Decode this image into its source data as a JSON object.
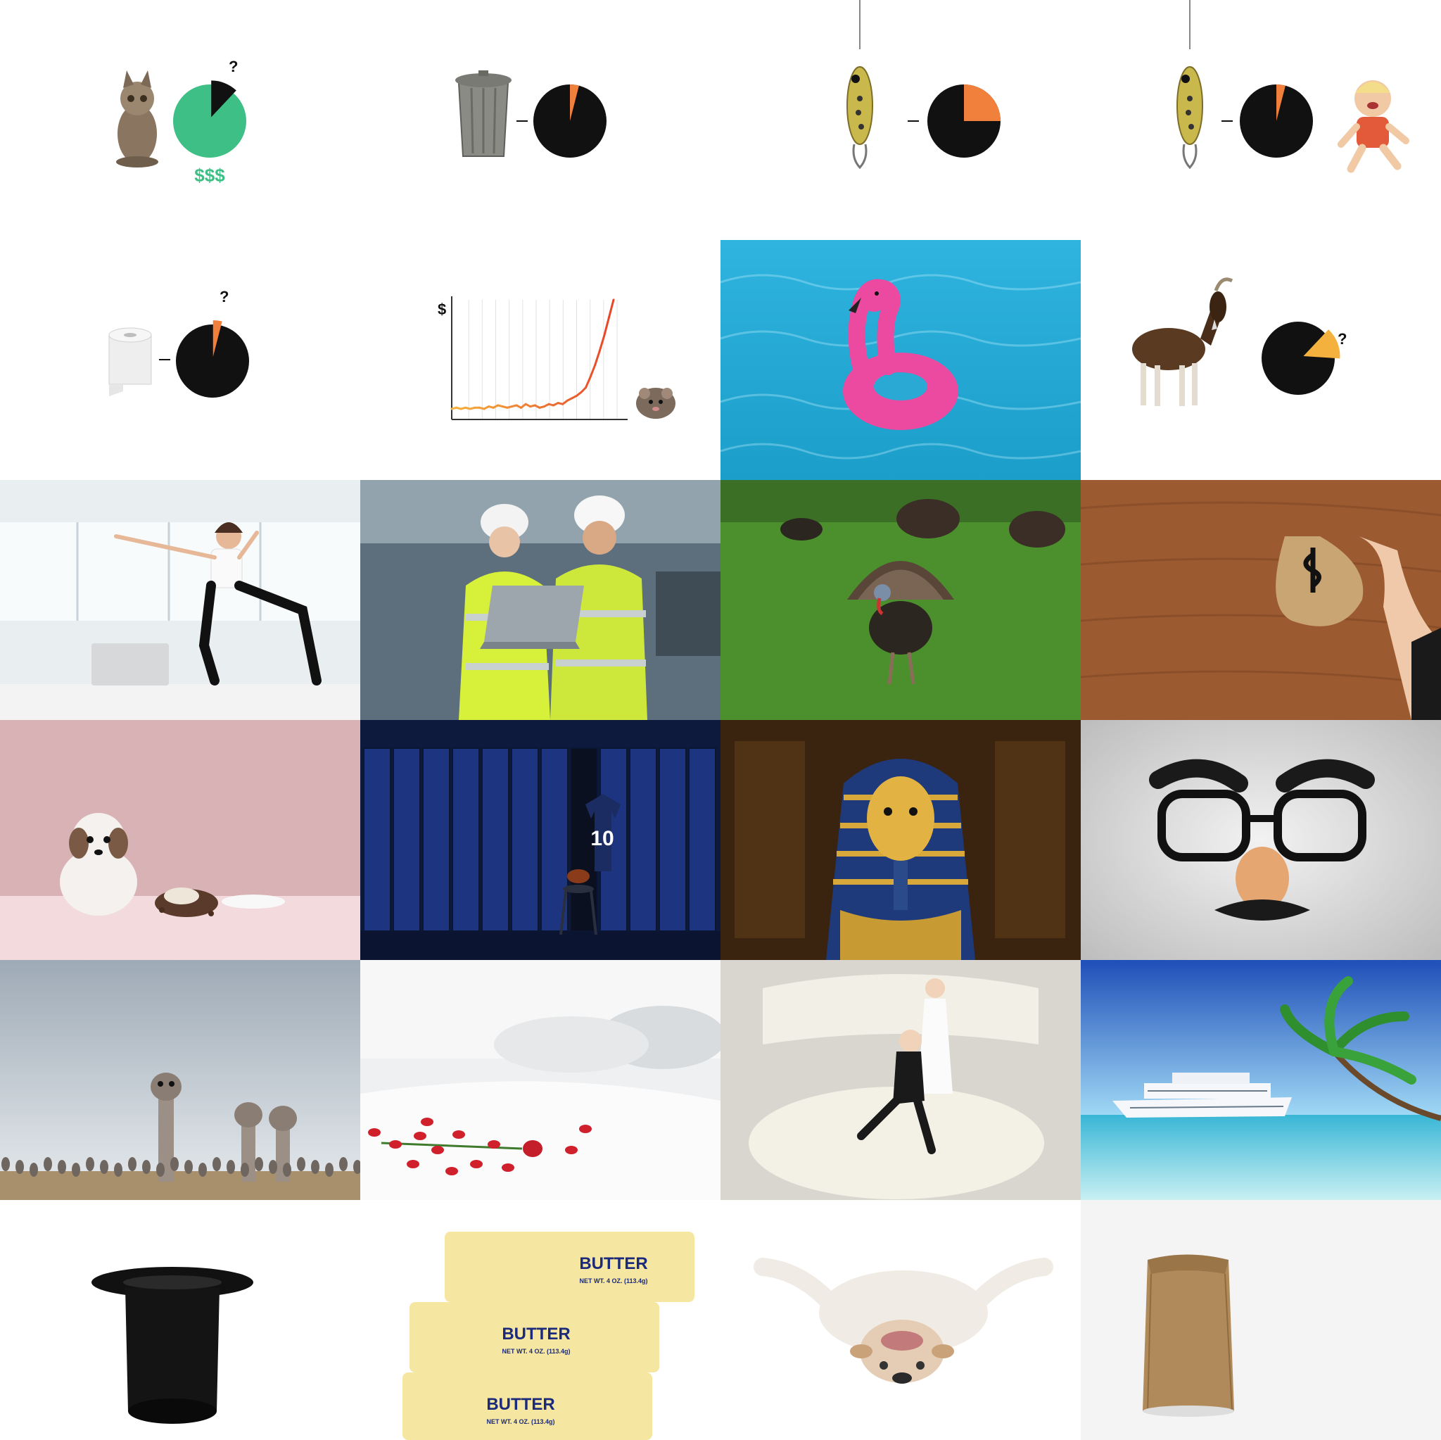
{
  "colors": {
    "green": "#3dbf85",
    "orange": "#f0803c",
    "orange_yellow": "#f5b13d",
    "black": "#111111"
  },
  "icons": {
    "kitten": "kitten-icon",
    "trash_can": "trash-can-icon",
    "fishing_lure": "fishing-lure-icon",
    "crying_toddler": "crying-toddler-icon",
    "toilet_paper": "toilet-paper-icon",
    "rat": "rat-icon",
    "goat": "goat-icon"
  },
  "tiles": {
    "kitten_pie": {
      "question": "?",
      "money": "$$$",
      "pie_fraction_missing": 0.12
    },
    "trash_pie": {
      "pie_fraction_orange": 0.04
    },
    "lure_pie": {
      "pie_fraction_orange": 0.25
    },
    "lure_toddler_pie": {
      "pie_fraction_orange": 0.04
    },
    "tp_pie": {
      "question": "?",
      "pie_fraction_orange": 0.04
    },
    "price_chart": {
      "ylabel": "$"
    },
    "goat_pie": {
      "question": "?",
      "pie_fraction_slice": 0.14
    },
    "butter": {
      "label1": "BUTTER",
      "label2": "BUTTER",
      "label3": "BUTTER",
      "net1": "NET WT. 4 OZ. (113.4g)",
      "net2": "NET WT. 4 OZ. (113.4g)",
      "net3": "NET WT. 4 OZ. (113.4g)"
    },
    "lockers": {
      "jersey_number": "10"
    }
  },
  "chart_data": {
    "type": "line",
    "ylabel": "$",
    "x": [
      1,
      2,
      3,
      4,
      5,
      6,
      7,
      8,
      9,
      10,
      11,
      12,
      13,
      14,
      15,
      16,
      17,
      18,
      19,
      20,
      21,
      22,
      23,
      24,
      25,
      26,
      27,
      28,
      29,
      30,
      31,
      32,
      33,
      34,
      35,
      36
    ],
    "y": [
      3,
      4,
      3,
      4,
      3,
      4,
      4,
      3,
      5,
      4,
      6,
      5,
      4,
      5,
      6,
      4,
      7,
      5,
      6,
      4,
      5,
      7,
      6,
      8,
      7,
      10,
      12,
      14,
      17,
      21,
      30,
      40,
      52,
      65,
      80,
      95
    ]
  }
}
